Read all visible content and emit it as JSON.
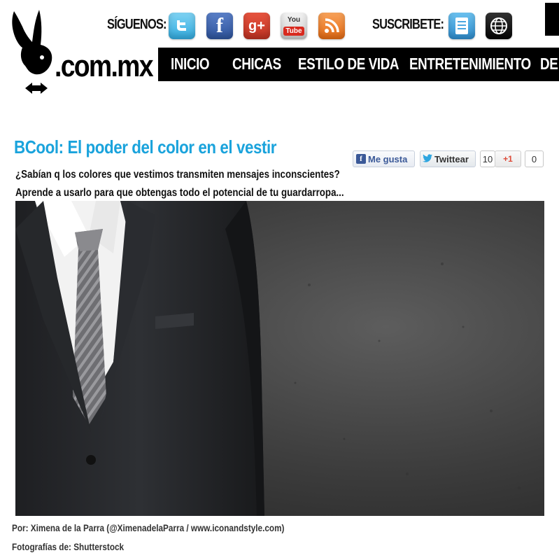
{
  "brand": {
    "logo_text": ".com.mx"
  },
  "header": {
    "follow_label": "SÍGUENOS:",
    "subscribe_label": "SUSCRIBETE:",
    "social_icons": [
      "twitter-icon",
      "facebook-icon",
      "google-plus-icon",
      "youtube-icon",
      "rss-icon"
    ],
    "subscribe_icons": [
      "newsletter-icon",
      "web-icon"
    ],
    "youtube_you": "You",
    "youtube_tube": "Tube",
    "facebook_glyph": "f",
    "gplus_glyph": "g+"
  },
  "nav": {
    "items": [
      "INICIO",
      "CHICAS",
      "ESTILO DE VIDA",
      "ENTRETENIMIENTO",
      "DE"
    ]
  },
  "article": {
    "title": "BCool: El poder del color en el vestir",
    "subtitle": "¿Sabían q los colores que vestimos transmiten mensajes inconscientes? Aprende a usarlo para que obtengas todo el potencial de tu guardarropa...",
    "author": "Por: Ximena de la Parra (@XimenadelaParra / www.iconandstyle.com)",
    "photo_credit": "Fotografías de: Shutterstock"
  },
  "share": {
    "fb_label": "Me gusta",
    "tw_label": "Twittear",
    "tw_count": "10",
    "gp_label": "+1",
    "gp_count": "0"
  },
  "colors": {
    "title": "#1aa3dc",
    "nav_bg": "#000000"
  }
}
